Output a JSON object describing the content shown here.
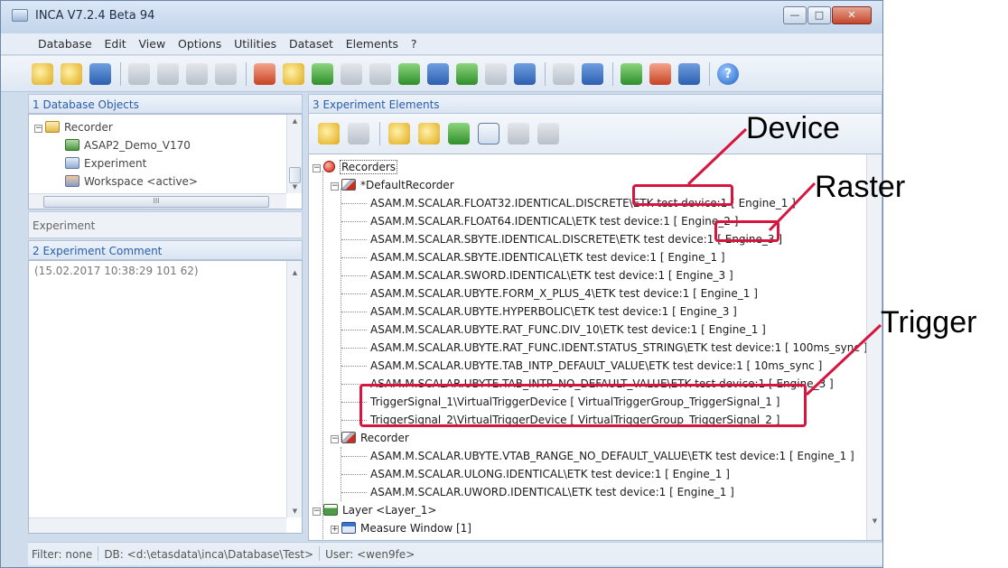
{
  "window": {
    "title": "INCA V7.2.4 Beta 94",
    "buttons": [
      "—",
      "□",
      "✕"
    ]
  },
  "menu": [
    "Database",
    "Edit",
    "View",
    "Options",
    "Utilities",
    "Dataset",
    "Elements",
    "?"
  ],
  "db_objects": {
    "header": "1 Database Objects",
    "items": [
      "Recorder",
      "ASAP2_Demo_V170",
      "Experiment",
      "Workspace <active>"
    ]
  },
  "experiment_label": "Experiment",
  "comment": {
    "header": "2 Experiment Comment",
    "text": "(15.02.2017 10:38:29 101 62)"
  },
  "experiment_elements": {
    "header": "3 Experiment Elements",
    "root": "Recorders",
    "default_recorder": "*DefaultRecorder",
    "default_items": [
      "ASAM.M.SCALAR.FLOAT32.IDENTICAL.DISCRETE\\ETK test device:1 [ Engine_1 ]",
      "ASAM.M.SCALAR.FLOAT64.IDENTICAL\\ETK test device:1 [ Engine_2 ]",
      "ASAM.M.SCALAR.SBYTE.IDENTICAL.DISCRETE\\ETK test device:1 [ Engine_3 ]",
      "ASAM.M.SCALAR.SBYTE.IDENTICAL\\ETK test device:1 [ Engine_1 ]",
      "ASAM.M.SCALAR.SWORD.IDENTICAL\\ETK test device:1 [ Engine_3 ]",
      "ASAM.M.SCALAR.UBYTE.FORM_X_PLUS_4\\ETK test device:1 [ Engine_1 ]",
      "ASAM.M.SCALAR.UBYTE.HYPERBOLIC\\ETK test device:1 [ Engine_3 ]",
      "ASAM.M.SCALAR.UBYTE.RAT_FUNC.DIV_10\\ETK test device:1 [ Engine_1 ]",
      "ASAM.M.SCALAR.UBYTE.RAT_FUNC.IDENT.STATUS_STRING\\ETK test device:1 [ 100ms_sync ]",
      "ASAM.M.SCALAR.UBYTE.TAB_INTP_DEFAULT_VALUE\\ETK test device:1 [ 10ms_sync ]",
      "ASAM.M.SCALAR.UBYTE.TAB_INTP_NO_DEFAULT_VALUE\\ETK test device:1 [ Engine_3 ]",
      "TriggerSignal_1\\VirtualTriggerDevice [ VirtualTriggerGroup_TriggerSignal_1 ]",
      "TriggerSignal_2\\VirtualTriggerDevice [ VirtualTriggerGroup_TriggerSignal_2 ]"
    ],
    "recorder": "Recorder",
    "recorder_items": [
      "ASAM.M.SCALAR.UBYTE.VTAB_RANGE_NO_DEFAULT_VALUE\\ETK test device:1 [ Engine_1 ]",
      "ASAM.M.SCALAR.ULONG.IDENTICAL\\ETK test device:1 [ Engine_1 ]",
      "ASAM.M.SCALAR.UWORD.IDENTICAL\\ETK test device:1 [ Engine_1 ]"
    ],
    "layer": "Layer <Layer_1>",
    "measure_window": "Measure Window [1]"
  },
  "status": {
    "filter": "Filter: none",
    "db": "DB: <d:\\etasdata\\inca\\Database\\Test>",
    "user": "User: <wen9fe>"
  },
  "callouts": {
    "device": "Device",
    "raster": "Raster",
    "trigger": "Trigger"
  },
  "colors": {
    "highlight": "#d6163f",
    "link_blue": "#2a5dab"
  }
}
